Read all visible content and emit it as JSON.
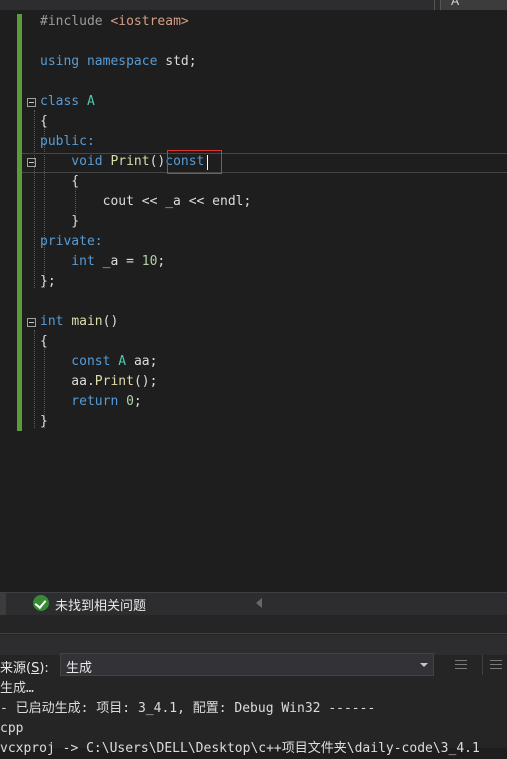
{
  "top_bar": {
    "dropdown_label": "A"
  },
  "editor": {
    "lines": [
      {
        "row": 1,
        "parts": [
          {
            "t": "#include ",
            "c": "pp"
          },
          {
            "t": "<iostream>",
            "c": "str"
          }
        ]
      },
      {
        "row": 3,
        "parts": [
          {
            "t": "using ",
            "c": "kw"
          },
          {
            "t": "namespace ",
            "c": "kw"
          },
          {
            "t": "std;",
            "c": "pl"
          }
        ]
      },
      {
        "row": 5,
        "parts": [
          {
            "t": "class ",
            "c": "kw"
          },
          {
            "t": "A",
            "c": "ty"
          }
        ]
      },
      {
        "row": 6,
        "parts": [
          {
            "t": "{",
            "c": "pl"
          }
        ]
      },
      {
        "row": 7,
        "parts": [
          {
            "t": "public:",
            "c": "kw"
          }
        ]
      },
      {
        "row": 8,
        "parts": [
          {
            "t": "    void ",
            "c": "kw"
          },
          {
            "t": "Print",
            "c": "fn"
          },
          {
            "t": "()",
            "c": "pl"
          },
          {
            "t": "const",
            "c": "kw"
          }
        ]
      },
      {
        "row": 9,
        "parts": [
          {
            "t": "    {",
            "c": "pl"
          }
        ]
      },
      {
        "row": 10,
        "parts": [
          {
            "t": "        cout << _a << endl;",
            "c": "pl"
          }
        ]
      },
      {
        "row": 11,
        "parts": [
          {
            "t": "    }",
            "c": "pl"
          }
        ]
      },
      {
        "row": 12,
        "parts": [
          {
            "t": "private:",
            "c": "kw"
          }
        ]
      },
      {
        "row": 13,
        "parts": [
          {
            "t": "    int ",
            "c": "kw"
          },
          {
            "t": "_a = ",
            "c": "pl"
          },
          {
            "t": "10",
            "c": "num"
          },
          {
            "t": ";",
            "c": "pl"
          }
        ]
      },
      {
        "row": 14,
        "parts": [
          {
            "t": "};",
            "c": "pl"
          }
        ]
      },
      {
        "row": 16,
        "parts": [
          {
            "t": "int ",
            "c": "kw"
          },
          {
            "t": "main",
            "c": "fn"
          },
          {
            "t": "()",
            "c": "pl"
          }
        ]
      },
      {
        "row": 17,
        "parts": [
          {
            "t": "{",
            "c": "pl"
          }
        ]
      },
      {
        "row": 18,
        "parts": [
          {
            "t": "    const ",
            "c": "kw"
          },
          {
            "t": "A ",
            "c": "ty"
          },
          {
            "t": "aa;",
            "c": "pl"
          }
        ]
      },
      {
        "row": 19,
        "parts": [
          {
            "t": "    aa.",
            "c": "pl"
          },
          {
            "t": "Print",
            "c": "fn"
          },
          {
            "t": "();",
            "c": "pl"
          }
        ]
      },
      {
        "row": 20,
        "parts": [
          {
            "t": "    return ",
            "c": "kw"
          },
          {
            "t": "0",
            "c": "num"
          },
          {
            "t": ";",
            "c": "pl"
          }
        ]
      },
      {
        "row": 21,
        "parts": [
          {
            "t": "}",
            "c": "pl"
          }
        ]
      }
    ]
  },
  "status_bar": {
    "issues_text": "未找到相关问题"
  },
  "output_panel": {
    "source_label_prefix": "来源(",
    "source_label_key": "S",
    "source_label_suffix": "):",
    "source_value": "生成",
    "lines": [
      "生成…",
      "- 已启动生成: 项目: 3_4.1, 配置: Debug Win32 ------",
      "cpp",
      "vcxproj -> C:\\Users\\DELL\\Desktop\\c++项目文件夹\\daily-code\\3_4.1"
    ]
  },
  "colors": {
    "background": "#1e1e1e",
    "keyword": "#569cd6",
    "type": "#4ec9b0",
    "function": "#dcdcaa",
    "number": "#b5cea8",
    "include_path": "#d69d85",
    "change_bar": "#5d9b3a",
    "highlight_box": "#e03131"
  }
}
